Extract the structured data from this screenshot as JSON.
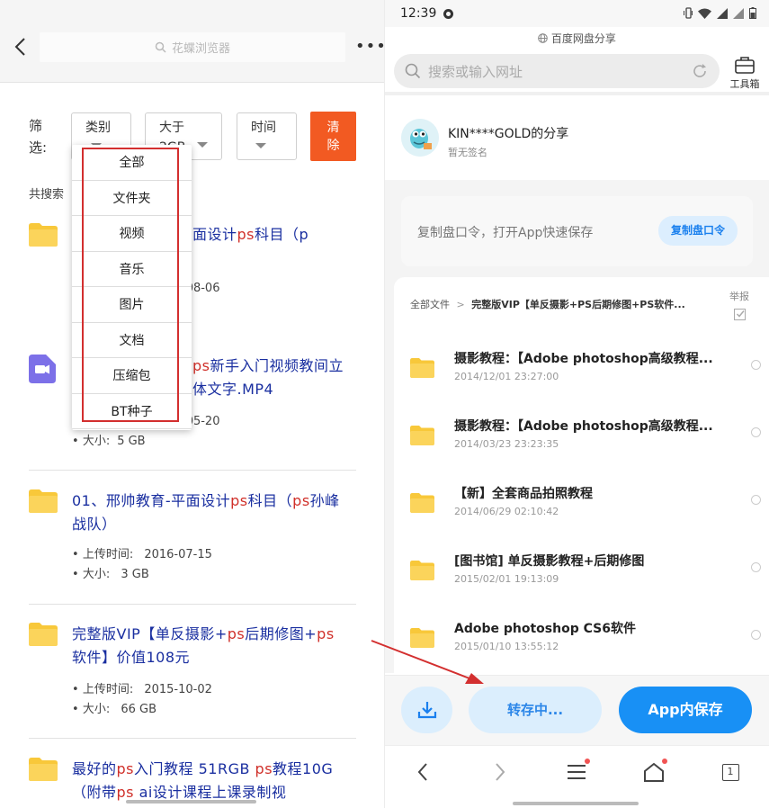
{
  "left": {
    "browser": {
      "url_placeholder": "花蝶浏览器",
      "more_label": "•••"
    },
    "filter": {
      "label": "筛选:",
      "category_label": "类别",
      "size_label": "大于 2GB",
      "time_label": "时间",
      "clear_label": "清除"
    },
    "search_total": "共搜索",
    "category_dropdown": [
      "全部",
      "文件夹",
      "视频",
      "音乐",
      "图片",
      "文档",
      "压缩包",
      "BT种子"
    ],
    "results": [
      {
        "icon": "folder-icon",
        "title_parts": [
          {
            "t": "面设计",
            "h": false
          },
          {
            "t": "ps",
            "h": true
          },
          {
            "t": "科目（p",
            "h": false
          }
        ],
        "meta": [
          {
            "k": "",
            "v": "-08-06"
          }
        ]
      },
      {
        "icon": "video-file-icon",
        "title_parts": [
          {
            "t": "ps",
            "h": true
          },
          {
            "t": "新手入门视频教",
            "h": false
          },
          {
            "t": "\n间立体文字.MP4",
            "h": false
          }
        ],
        "meta": [
          {
            "k": "",
            "v": "-05-20"
          },
          {
            "k": "大小:",
            "v": "5 GB"
          }
        ]
      },
      {
        "icon": "folder-icon",
        "title_parts": [
          {
            "t": "01、邢帅教育-平面设计",
            "h": false
          },
          {
            "t": "ps",
            "h": true
          },
          {
            "t": "科目（",
            "h": false
          },
          {
            "t": "p",
            "h": true
          },
          {
            "t": "s",
            "h": true
          },
          {
            "t": "孙峰战队）",
            "h": false
          }
        ],
        "meta": [
          {
            "k": "上传时间:",
            "v": "2016-07-15"
          },
          {
            "k": "大小:",
            "v": "3 GB"
          }
        ]
      },
      {
        "icon": "folder-icon",
        "title_parts": [
          {
            "t": "完整版VIP【单反摄影+",
            "h": false
          },
          {
            "t": "ps",
            "h": true
          },
          {
            "t": "后期修图+",
            "h": false
          },
          {
            "t": "ps",
            "h": true
          },
          {
            "t": "软件】价值108元",
            "h": false
          }
        ],
        "meta": [
          {
            "k": "上传时间:",
            "v": "2015-10-02"
          },
          {
            "k": "大小:",
            "v": "66 GB"
          }
        ]
      },
      {
        "icon": "folder-icon",
        "title_parts": [
          {
            "t": "最好的",
            "h": false
          },
          {
            "t": "ps",
            "h": true
          },
          {
            "t": "入门教程 51RGB ",
            "h": false
          },
          {
            "t": "ps",
            "h": true
          },
          {
            "t": "教程10G（附带",
            "h": false
          },
          {
            "t": "ps",
            "h": true
          },
          {
            "t": " ai设计课程上课录制视",
            "h": false
          }
        ],
        "meta": []
      }
    ]
  },
  "right": {
    "status": {
      "time": "12:39"
    },
    "site_title": "百度网盘分享",
    "search_placeholder": "搜索或输入网址",
    "toolbox_label": "工具箱",
    "sharer": {
      "name": "KIN****GOLD的分享",
      "signature": "暂无签名"
    },
    "copy_card": {
      "text": "复制盘口令，打开App快速保存",
      "button": "复制盘口令"
    },
    "breadcrumb": {
      "root": "全部文件",
      "sep": ">",
      "current": "完整版VIP【单反摄影+PS后期修图+PS软件..."
    },
    "report_label": "举报",
    "files": [
      {
        "name": "摄影教程：【Adobe photoshop高级教程...",
        "date": "2014/12/01 23:27:00"
      },
      {
        "name": "摄影教程：【Adobe photoshop高级教程...",
        "date": "2014/03/23 23:23:35"
      },
      {
        "name": "【新】全套商品拍照教程",
        "date": "2014/06/29 02:10:42"
      },
      {
        "name": "[图书馆] 单反摄影教程+后期修图",
        "date": "2015/02/01 19:13:09"
      },
      {
        "name": "Adobe photoshop CS6软件",
        "date": "2015/01/10 13:55:12"
      }
    ],
    "actions": {
      "transfer": "转存中...",
      "app_save": "App内保存"
    },
    "nav": {
      "tabs_count": "1"
    }
  }
}
